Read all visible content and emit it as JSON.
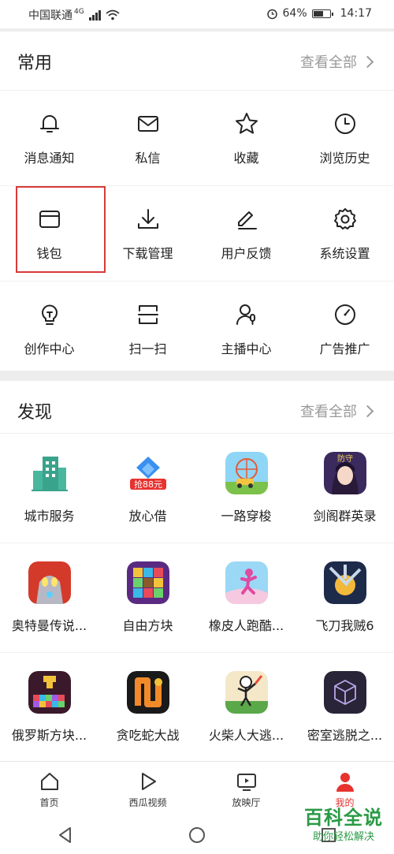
{
  "status": {
    "carrier": "中国联通",
    "network": "4G",
    "battery": "64%",
    "time": "14:17",
    "battery_level": 0.64
  },
  "common": {
    "title": "常用",
    "view_all": "查看全部",
    "items": [
      {
        "label": "消息通知",
        "icon": "bell-icon"
      },
      {
        "label": "私信",
        "icon": "mail-icon"
      },
      {
        "label": "收藏",
        "icon": "star-icon"
      },
      {
        "label": "浏览历史",
        "icon": "clock-icon"
      },
      {
        "label": "钱包",
        "icon": "wallet-icon"
      },
      {
        "label": "下载管理",
        "icon": "download-icon"
      },
      {
        "label": "用户反馈",
        "icon": "feedback-icon"
      },
      {
        "label": "系统设置",
        "icon": "gear-icon"
      },
      {
        "label": "创作中心",
        "icon": "lightbulb-icon"
      },
      {
        "label": "扫一扫",
        "icon": "scan-icon"
      },
      {
        "label": "主播中心",
        "icon": "anchor-icon"
      },
      {
        "label": "广告推广",
        "icon": "gauge-icon"
      }
    ]
  },
  "discover": {
    "title": "发现",
    "view_all": "查看全部",
    "apps": [
      {
        "label": "城市服务",
        "icon": "city-service-icon"
      },
      {
        "label": "放心借",
        "icon": "loan-icon",
        "badge": "抢88元"
      },
      {
        "label": "一路穿梭",
        "icon": "ferris-wheel-icon"
      },
      {
        "label": "剑阁群英录",
        "icon": "game-girl-icon"
      },
      {
        "label": "奥特曼传说...",
        "icon": "ultraman-icon"
      },
      {
        "label": "自由方块",
        "icon": "blocks-icon"
      },
      {
        "label": "橡皮人跑酷...",
        "icon": "runner-icon"
      },
      {
        "label": "飞刀我贼6",
        "icon": "knife-icon"
      },
      {
        "label": "俄罗斯方块...",
        "icon": "tetris-icon"
      },
      {
        "label": "贪吃蛇大战",
        "icon": "snake-icon"
      },
      {
        "label": "火柴人大逃...",
        "icon": "stickman-icon"
      },
      {
        "label": "密室逃脱之...",
        "icon": "cube-icon"
      }
    ]
  },
  "tabs": [
    {
      "label": "首页",
      "icon": "home-icon"
    },
    {
      "label": "西瓜视频",
      "icon": "play-icon"
    },
    {
      "label": "放映厅",
      "icon": "tv-play-icon"
    },
    {
      "label": "我的",
      "icon": "profile-icon",
      "active": true
    }
  ],
  "watermark": {
    "title": "百科全说",
    "subtitle": "助你轻松解决"
  },
  "colors": {
    "accent": "#e7322e",
    "highlight_box": "#d63a3a",
    "watermark": "#2a9a45"
  }
}
